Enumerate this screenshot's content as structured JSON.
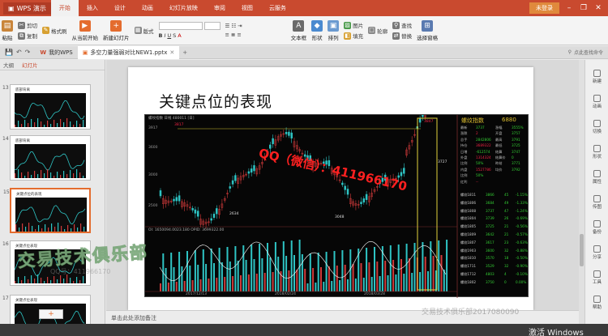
{
  "app": {
    "badge": "WPS 演示",
    "login": "未登录"
  },
  "menu_tabs": [
    "开始",
    "插入",
    "设计",
    "动画",
    "幻灯片放映",
    "审阅",
    "视图",
    "云服务"
  ],
  "ribbon": {
    "paste": "粘贴",
    "cut": "剪切",
    "copy": "复制",
    "format_painter": "格式刷",
    "from_current": "从当前开始",
    "new_slide": "新建幻灯片",
    "layout": "版式",
    "textbox": "文本框",
    "shape": "形状",
    "picture": "图片",
    "fill": "填充",
    "arrange": "排列",
    "outline": "轮廓",
    "find": "查找",
    "replace": "替换",
    "select_pane": "选择窗格"
  },
  "doc_tabs": [
    {
      "label": "我的WPS",
      "active": false
    },
    {
      "label": "多空力量强弱对比NEW1.pptx",
      "active": true
    }
  ],
  "search_cmd": "点此查找命令",
  "left_panel": {
    "tabs": [
      "大纲",
      "幻灯片"
    ],
    "slides": [
      {
        "num": "13",
        "title": "底部背离"
      },
      {
        "num": "14",
        "title": "底部背离"
      },
      {
        "num": "15",
        "title": "关键点位的表现"
      },
      {
        "num": "16",
        "title": "关键点位表现"
      },
      {
        "num": "17",
        "title": "关键点位表现"
      }
    ]
  },
  "slide": {
    "title": "关键点位的表现"
  },
  "chart_panel": {
    "header": "螺纹指数",
    "price": "6880",
    "top_label": "螺纹指数 日线 480011 [日]",
    "indicator_label": "OI: 1650094.0023.180 OPID: 3699322.00",
    "left_stats": [
      {
        "k": "最新",
        "v": "3737"
      },
      {
        "k": "涨跌",
        "v": "2"
      },
      {
        "k": "总手",
        "v": "2842806"
      },
      {
        "k": "持仓",
        "v": "3689322"
      },
      {
        "k": "日增",
        "v": "-612574"
      },
      {
        "k": "外盘",
        "v": "1314324"
      },
      {
        "k": "比例",
        "v": "50%"
      },
      {
        "k": "内盘",
        "v": "1527786"
      },
      {
        "k": "比例",
        "v": "50%"
      },
      {
        "k": "红利",
        "v": "--"
      }
    ],
    "right_stats": [
      {
        "k": "涨幅",
        "v": "3555%"
      },
      {
        "k": "开盘",
        "v": "3757"
      },
      {
        "k": "最高",
        "v": "3791"
      },
      {
        "k": "最低",
        "v": "3725"
      },
      {
        "k": "结算",
        "v": "3747"
      },
      {
        "k": "结算价",
        "v": "0"
      },
      {
        "k": "昨结",
        "v": "3771"
      },
      {
        "k": "均价",
        "v": "3792"
      }
    ],
    "contracts": [
      {
        "name": "螺纹1811",
        "price": "3866",
        "chg": "45",
        "pct": "-1.15%"
      },
      {
        "name": "螺纹1806",
        "price": "3684",
        "chg": "49",
        "pct": "-1.33%"
      },
      {
        "name": "螺纹1808",
        "price": "3737",
        "chg": "47",
        "pct": "-1.24%"
      },
      {
        "name": "螺纹1804",
        "price": "3739",
        "chg": "26",
        "pct": "-0.69%"
      },
      {
        "name": "螺纹1805",
        "price": "3725",
        "chg": "21",
        "pct": "-0.56%"
      },
      {
        "name": "螺纹1809",
        "price": "3642",
        "chg": "21",
        "pct": "-0.57%"
      },
      {
        "name": "螺纹1807",
        "price": "3617",
        "chg": "23",
        "pct": "-0.63%"
      },
      {
        "name": "螺纹1903",
        "price": "3600",
        "chg": "32",
        "pct": "-0.88%"
      },
      {
        "name": "螺纹1810",
        "price": "3570",
        "chg": "18",
        "pct": "-0.50%"
      },
      {
        "name": "螺纹1711",
        "price": "3529",
        "chg": "32",
        "pct": "-0.90%"
      },
      {
        "name": "螺纹1712",
        "price": "4803",
        "chg": "4",
        "pct": "-0.10%"
      },
      {
        "name": "螺纹1802",
        "price": "3750",
        "chg": "0",
        "pct": "0.00%"
      }
    ],
    "price_labels": {
      "top": "3917",
      "mid_high": "3600",
      "mid": "3000",
      "low": "2500"
    },
    "annot": {
      "a1": "3817",
      "a2": "3048",
      "a3": "2634",
      "a4": "3727",
      "a5": "3847"
    },
    "date_labels": [
      "2017/12/13",
      "2018/02/24",
      "2018/03/28"
    ]
  },
  "notes": "单击此处添加备注",
  "right_panel": [
    "新建",
    "动画",
    "切换",
    "形状",
    "属性",
    "传图",
    "备份",
    "分享",
    "工具",
    "帮助"
  ],
  "watermarks": {
    "qq": "QQ（微信）：411966170",
    "club": "交易技术俱乐部",
    "phone": "交易技术俱乐部2017080090",
    "small": "QQ号：411966170"
  },
  "status": {
    "activate": "激活 Windows"
  },
  "colors": {
    "accent": "#c94a2f",
    "up": "#2ec4c4",
    "down": "#d03a3a",
    "highlight": "#e0d23c"
  }
}
